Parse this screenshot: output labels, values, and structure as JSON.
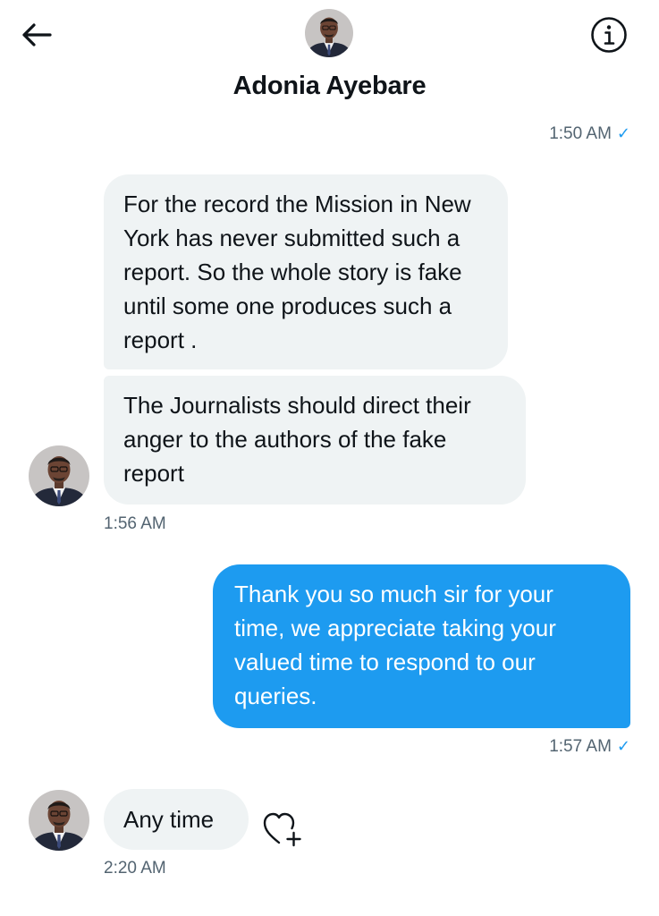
{
  "header": {
    "contact_name": "Adonia Ayebare",
    "back_icon": "arrow-left-icon",
    "info_icon": "info-icon"
  },
  "messages": [
    {
      "id": "m0",
      "sender": "me",
      "timestamp": "1:50 AM",
      "read": true
    },
    {
      "id": "m1",
      "sender": "contact",
      "text": "For the record the Mission in New York has never submitted such a report. So the whole story is fake until some one produces such a report ."
    },
    {
      "id": "m2",
      "sender": "contact",
      "text": "The Journalists should direct their anger to the authors of the fake report",
      "timestamp": "1:56 AM"
    },
    {
      "id": "m3",
      "sender": "me",
      "text": "Thank you so much sir for your time, we appreciate taking your valued time to respond to our queries.",
      "timestamp": "1:57 AM",
      "read": true
    },
    {
      "id": "m4",
      "sender": "contact",
      "text": "Any time",
      "timestamp": "2:20 AM"
    }
  ],
  "colors": {
    "accent": "#1d9bf0",
    "received_bubble": "#eff3f4",
    "timestamp": "#536471",
    "text": "#0f1419"
  }
}
